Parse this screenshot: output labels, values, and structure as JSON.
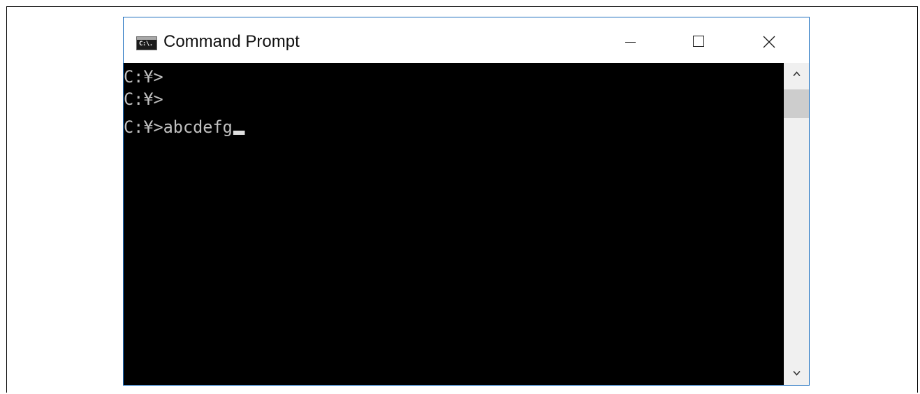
{
  "window": {
    "title": "Command Prompt",
    "icon_label": "C:\\.",
    "buttons": {
      "minimize": "minimize-icon",
      "maximize": "maximize-icon",
      "close": "close-icon"
    },
    "border_color": "#1e6fbf"
  },
  "console": {
    "background": "#000000",
    "text_color": "#c0c0c0",
    "lines": [
      "C:¥>",
      "C:¥>",
      "C:¥>abcdefg"
    ]
  },
  "scrollbar": {
    "up_icon": "chevron-up-icon",
    "down_icon": "chevron-down-icon"
  }
}
